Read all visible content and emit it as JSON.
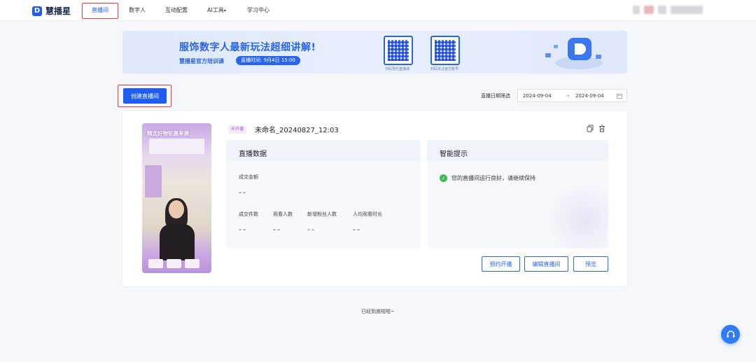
{
  "app": {
    "name": "慧播星"
  },
  "nav": {
    "items": [
      {
        "label": "直播间",
        "active": true
      },
      {
        "label": "数字人"
      },
      {
        "label": "互动配置"
      },
      {
        "label": "AI工具"
      },
      {
        "label": "学习中心"
      }
    ]
  },
  "banner": {
    "title": "服饰数字人最新玩法超细讲解!",
    "subtitle": "慧播星官方培训课",
    "live_time": "直播时间: 9月4日 15:00",
    "qr1_caption": "扫码预约直播课",
    "qr2_caption": "扫码关注官方账号"
  },
  "toolbar": {
    "create_label": "创建直播间",
    "date_filter_label": "直播日期筛选",
    "date_start": "2024-09-04",
    "date_sep": "→",
    "date_end": "2024-09-04"
  },
  "room": {
    "status": "未开播",
    "name": "未命名_20240827_12:03",
    "thumb_title": "精选好物钜惠来袭",
    "data_title": "直播数据",
    "tips_title": "智能提示",
    "metrics": {
      "gmv_label": "成交金额",
      "gmv_value": "--",
      "orders_label": "成交件数",
      "orders_value": "--",
      "viewers_label": "观看人数",
      "viewers_value": "--",
      "fans_label": "新增粉丝人数",
      "fans_value": "--",
      "avg_time_label": "人均观看时长",
      "avg_time_value": "--"
    },
    "tip": "您的直播间运行良好，请继续保持",
    "actions": {
      "schedule": "预约开播",
      "edit": "编辑直播间",
      "preview": "预览"
    }
  },
  "footer": {
    "note": "已经到底啦啦~"
  },
  "colors": {
    "primary": "#1f5cf0",
    "highlight": "#e53a3a",
    "tag": "#a45ed8"
  }
}
